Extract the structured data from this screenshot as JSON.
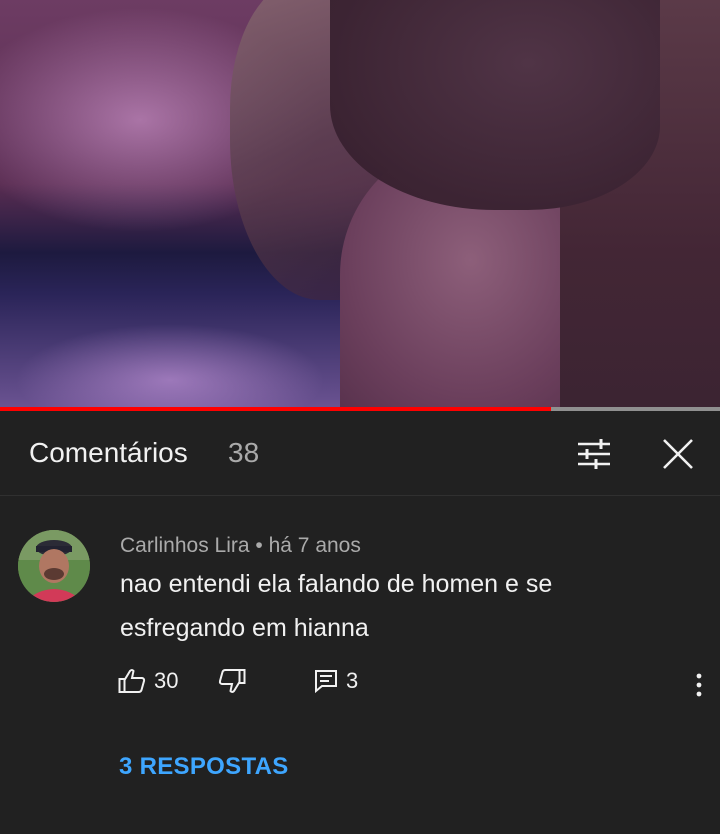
{
  "video": {
    "progress_fraction": 0.765
  },
  "comments_panel": {
    "title": "Comentários",
    "count": "38",
    "icons": {
      "filter": "sort-filter-icon",
      "close": "close-icon"
    }
  },
  "comment": {
    "author": "Carlinhos Lira",
    "separator": "•",
    "time": "há 7 anos",
    "text": "nao entendi ela falando de homen e se esfregando em hianna",
    "likes": "30",
    "replies_count": "3",
    "replies_link": "3 RESPOSTAS",
    "icons": {
      "like": "thumbs-up-icon",
      "dislike": "thumbs-down-icon",
      "reply": "comment-reply-icon",
      "more": "more-vertical-icon"
    }
  },
  "colors": {
    "background": "#212121",
    "accent_link": "#3ea6ff",
    "progress": "#ff0000",
    "secondary_text": "#aaaaaa"
  }
}
